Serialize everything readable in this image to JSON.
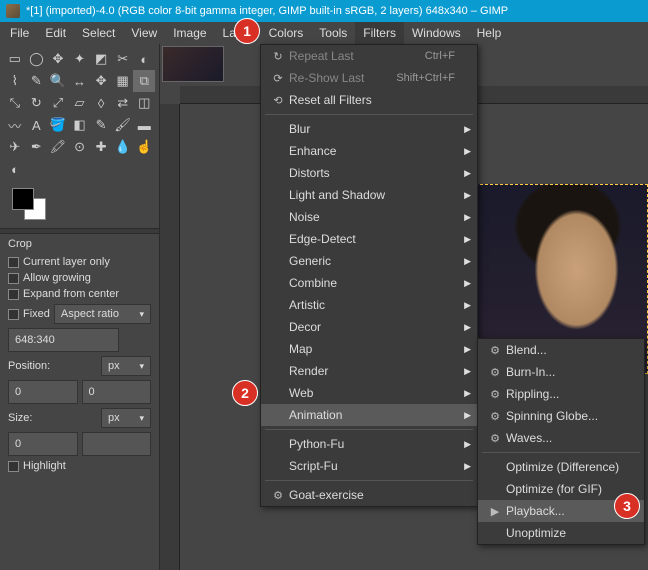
{
  "titlebar": {
    "text": "*[1] (imported)-4.0 (RGB color 8-bit gamma integer, GIMP built-in sRGB, 2 layers) 648x340 – GIMP"
  },
  "menubar": {
    "items": [
      "File",
      "Edit",
      "Select",
      "View",
      "Image",
      "Layer",
      "Colors",
      "Tools",
      "Filters",
      "Windows",
      "Help"
    ],
    "active_index": 8
  },
  "tool_options": {
    "title": "Crop",
    "current_layer_only": "Current layer only",
    "allow_growing": "Allow growing",
    "expand_from_center": "Expand from center",
    "fixed": "Fixed",
    "aspect_mode": "Aspect ratio",
    "ratio": "648:340",
    "position_label": "Position:",
    "position_unit": "px",
    "position_x": "0",
    "position_y": "0",
    "size_label": "Size:",
    "size_unit": "px",
    "size_w": "0",
    "highlight": "Highlight"
  },
  "filters_menu": {
    "repeat_last": "Repeat Last",
    "repeat_last_short": "Ctrl+F",
    "reshow_last": "Re-Show Last",
    "reshow_last_short": "Shift+Ctrl+F",
    "reset_all": "Reset all Filters",
    "groups": [
      "Blur",
      "Enhance",
      "Distorts",
      "Light and Shadow",
      "Noise",
      "Edge-Detect",
      "Generic",
      "Combine",
      "Artistic",
      "Decor",
      "Map",
      "Render",
      "Web",
      "Animation"
    ],
    "python_fu": "Python-Fu",
    "script_fu": "Script-Fu",
    "goat": "Goat-exercise"
  },
  "animation_menu": {
    "blend": "Blend...",
    "burn_in": "Burn-In...",
    "rippling": "Rippling...",
    "spinning_globe": "Spinning Globe...",
    "waves": "Waves...",
    "optimize_diff": "Optimize (Difference)",
    "optimize_gif": "Optimize (for GIF)",
    "playback": "Playback...",
    "unoptimize": "Unoptimize"
  },
  "callouts": {
    "c1": "1",
    "c2": "2",
    "c3": "3"
  }
}
